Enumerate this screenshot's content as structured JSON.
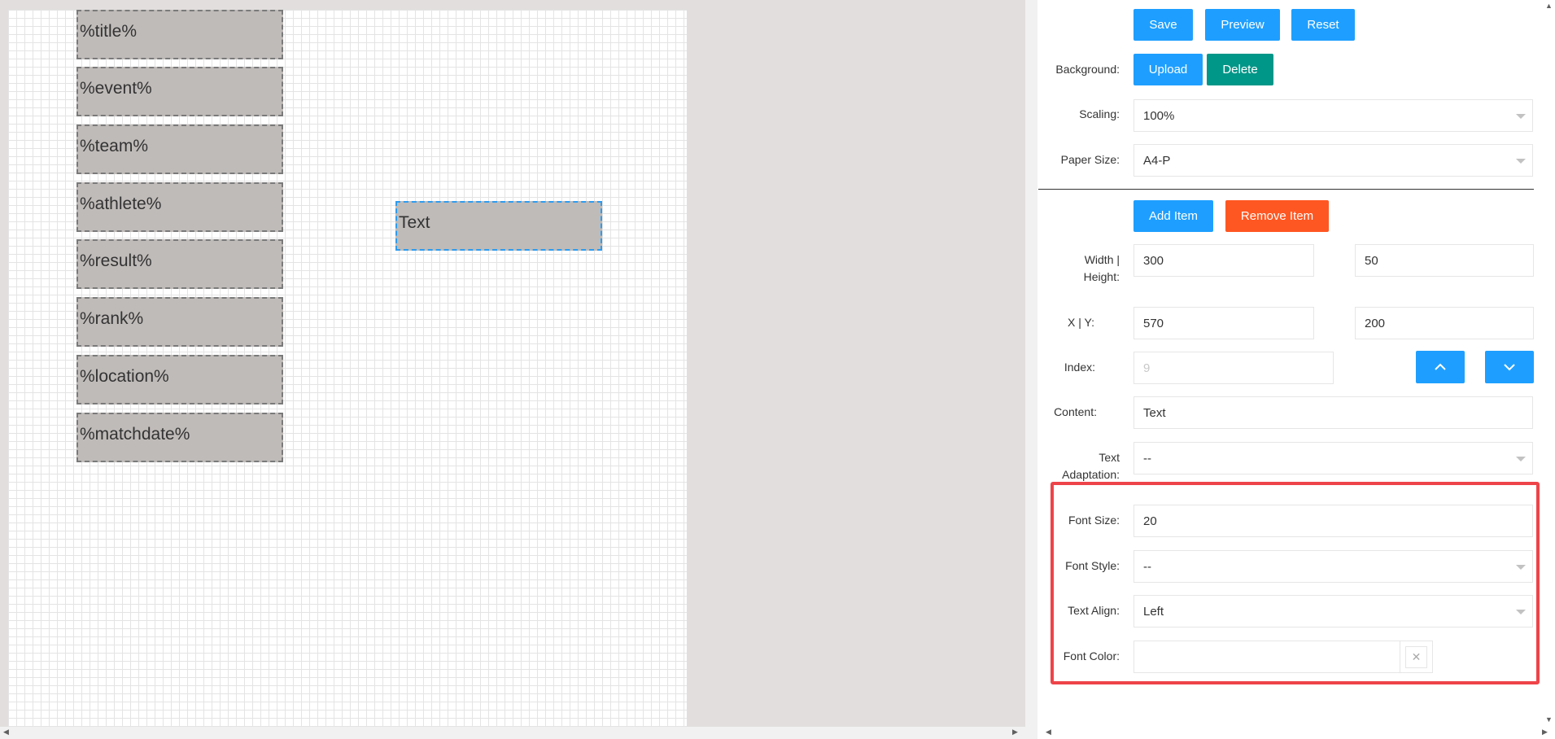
{
  "canvas": {
    "fields": [
      "%title%",
      "%event%",
      "%team%",
      "%athlete%",
      "%result%",
      "%rank%",
      "%location%",
      "%matchdate%"
    ],
    "selected_item": "Text"
  },
  "toolbar": {
    "save": "Save",
    "preview": "Preview",
    "reset": "Reset"
  },
  "background": {
    "label": "Background:",
    "upload": "Upload",
    "delete": "Delete"
  },
  "scaling": {
    "label": "Scaling:",
    "value": "100%"
  },
  "paper_size": {
    "label": "Paper Size:",
    "value": "A4-P"
  },
  "items": {
    "add": "Add Item",
    "remove": "Remove Item"
  },
  "size": {
    "label_line1": "Width |",
    "label_line2": "Height:",
    "width": "300",
    "height": "50"
  },
  "position": {
    "label": "X | Y:",
    "x": "570",
    "y": "200"
  },
  "index": {
    "label": "Index:",
    "placeholder": "9"
  },
  "content": {
    "label": "Content:",
    "value": "Text"
  },
  "text_adaptation": {
    "label_line1": "Text",
    "label_line2": "Adaptation:",
    "value": "--"
  },
  "font_size": {
    "label": "Font Size:",
    "value": "20"
  },
  "font_style": {
    "label": "Font Style:",
    "value": "--"
  },
  "text_align": {
    "label": "Text Align:",
    "value": "Left"
  },
  "font_color": {
    "label": "Font Color:",
    "value": "",
    "clear_glyph": "✕"
  },
  "colors": {
    "primary": "#1e9fff",
    "teal": "#009688",
    "orange": "#ff5722",
    "highlight": "#ee4449",
    "selected_border": "#2d9cf0"
  }
}
